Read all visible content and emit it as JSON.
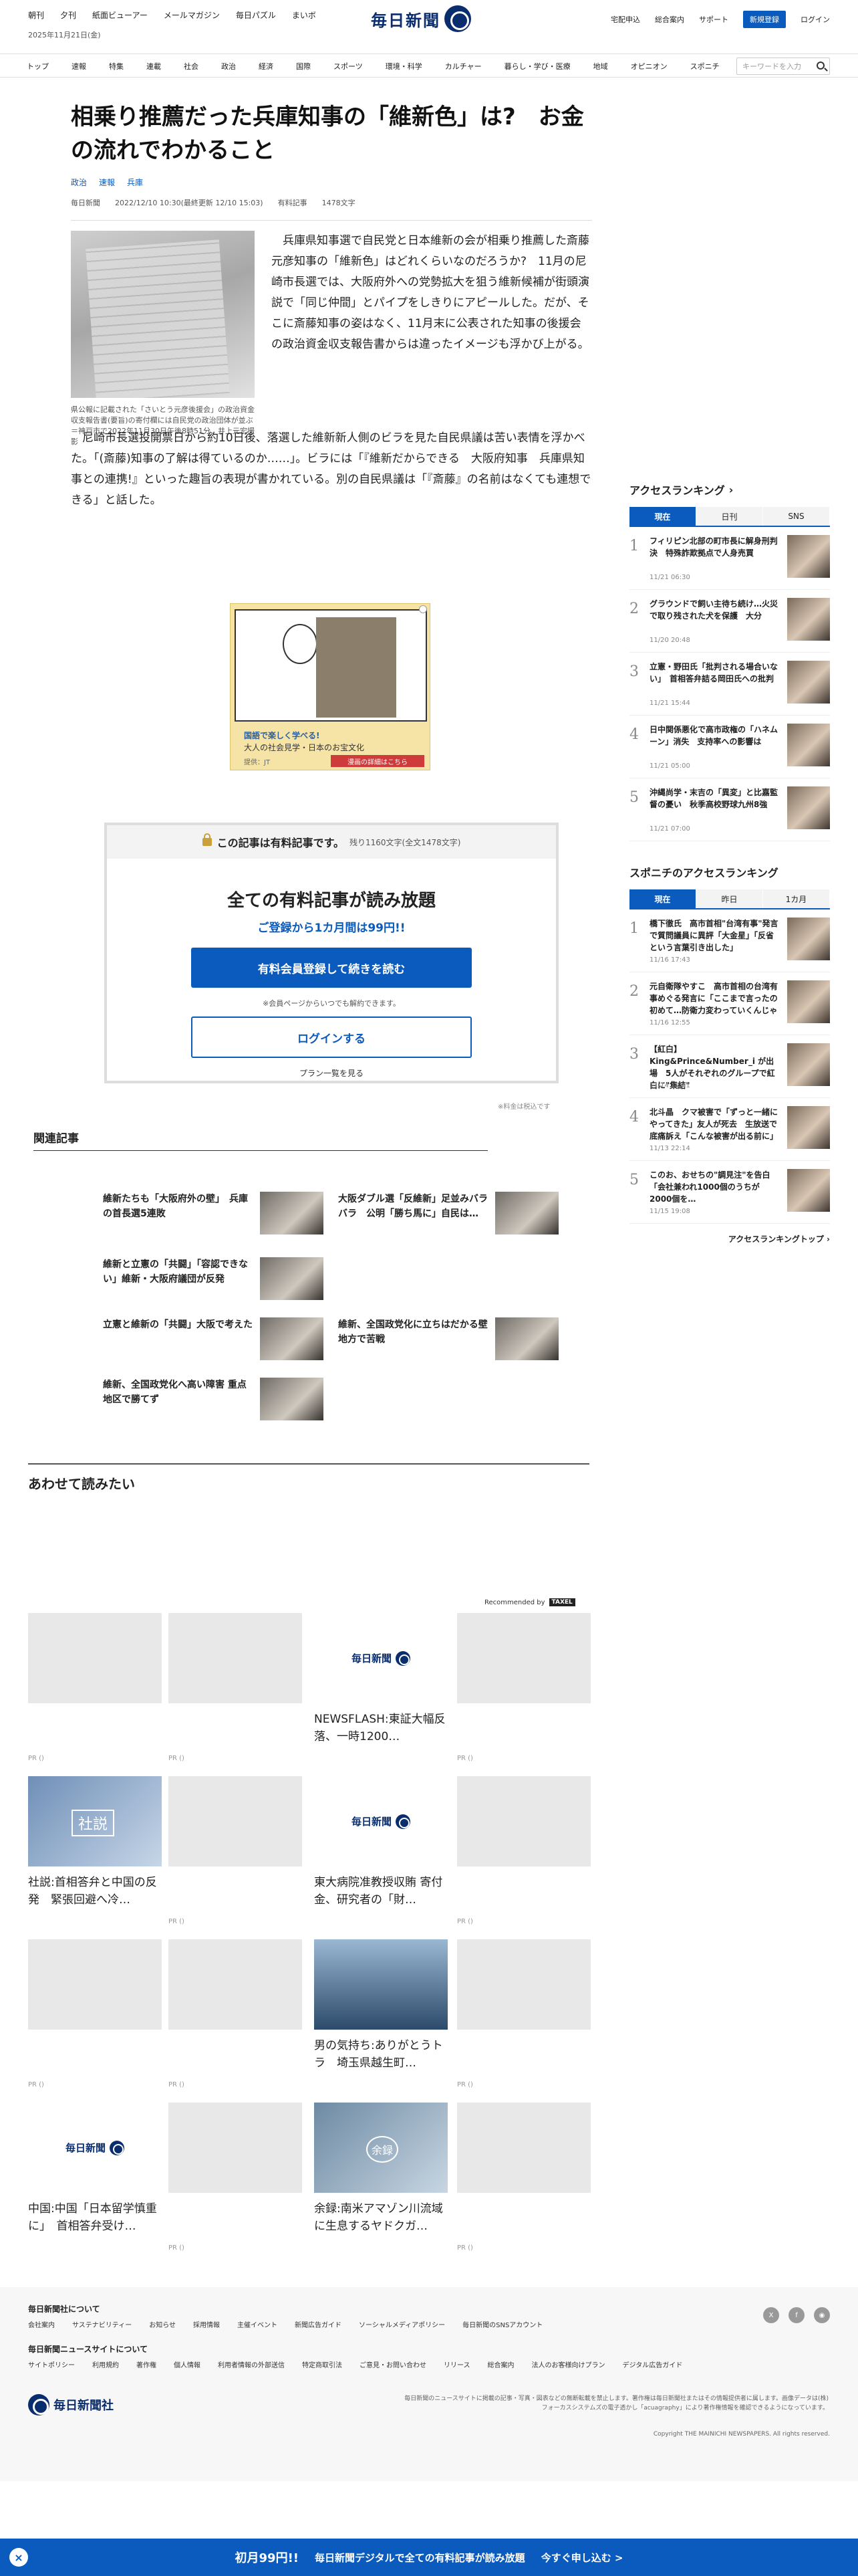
{
  "header": {
    "top_links": [
      "朝刊",
      "夕刊",
      "紙面ビューアー",
      "メールマガジン",
      "毎日パズル",
      "まいボ"
    ],
    "date": "2025年11月21日(金)",
    "logo_text": "毎日新聞",
    "right_links": [
      "宅配申込",
      "総合案内",
      "サポート"
    ],
    "register_label": "新規登録",
    "login_label": "ログイン"
  },
  "nav": {
    "items": [
      "トップ",
      "速報",
      "特集",
      "連載",
      "社会",
      "政治",
      "経済",
      "国際",
      "スポーツ",
      "環境・科学",
      "カルチャー",
      "暮らし・学び・医療",
      "地域",
      "オピニオン",
      "スポニチ"
    ],
    "search_placeholder": "キーワードを入力"
  },
  "article": {
    "title": "相乗り推薦だった兵庫知事の「維新色」は?　お金の流れでわかること",
    "tags": [
      "政治",
      "速報",
      "兵庫"
    ],
    "source": "毎日新聞",
    "date": "2022/12/10 10:30(最終更新 12/10 15:03)",
    "paid_label": "有料記事",
    "char_count": "1478文字",
    "photo_caption": "県公報に記載された「さいとう元彦後援会」の政治資金収支報告書(要旨)の寄付欄には自民党の政治団体が並ぶ＝神戸市で2022年11月30日午後8時51分、井上元宏撮影",
    "para1": "兵庫県知事選で自民党と日本維新の会が相乗り推薦した斎藤元彦知事の「維新色」はどれくらいなのだろうか?　11月の尼崎市長選では、大阪府外への党勢拡大を狙う維新候補が街頭演説で「同じ仲間」とパイプをしきりにアピールした。だが、そこに斎藤知事の姿はなく、11月末に公表された知事の後援会の政治資金収支報告書からは違ったイメージも浮かび上がる。",
    "para2": "尼崎市長選投開票日から約10日後、落選した維新新人側のビラを見た自民県議は苦い表情を浮かべた。「(斎藤)知事の了解は得ているのか……」。ビラには「『維新だからできる　大阪府知事　兵庫県知事との連携!』といった趣旨の表現が書かれている。別の自民県議は「『斎藤』の名前はなくても連想できる」と話した。"
  },
  "ad": {
    "line1": "国語で楽しく学べる!",
    "line2": "大人の社会見学・日本のお宝文化",
    "line3": "提供：JT",
    "cta": "漫画の詳細はこちら"
  },
  "paywall": {
    "head": "この記事は有料記事です。",
    "remaining": "残り1160文字(全文1478文字)",
    "title": "全ての有料記事が読み放題",
    "subtitle": "ご登録から1カ月間は99円!!",
    "primary_button": "有料会員登録して続きを読む",
    "note": "※会員ページからいつでも解約できます。",
    "login_button": "ログインする",
    "plan_link": "プラン一覧を見る",
    "tax_note": "※料金は税込です"
  },
  "related": {
    "heading": "関連記事",
    "items": [
      "維新たちも「大阪府外の壁」　兵庫の首長選5連敗",
      "大阪ダブル選「反維新」足並みバラバラ　公明「勝ち馬に」自民は…",
      "維新と立憲の「共闘」「容認できない」維新・大阪府議団が反発",
      "立憲と維新の「共闘」大阪で考えた",
      "維新、全国政党化に立ちはだかる壁　地方で苦戦",
      "維新、全国政党化へ高い障害 重点地区で勝てず"
    ]
  },
  "awase": {
    "heading": "あわせて読みたい",
    "recommended_by": "Recommended by",
    "provider": "TAXEL",
    "cards": [
      {
        "text": "",
        "pr": "PR ()"
      },
      {
        "text": "",
        "pr": "PR ()"
      },
      {
        "text": "NEWSFLASH:東証大幅反落、一時1200…",
        "pr": ""
      },
      {
        "text": "",
        "pr": "PR ()"
      },
      {
        "text": "社説:首相答弁と中国の反発　緊張回避へ冷…",
        "pr": ""
      },
      {
        "text": "",
        "pr": "PR ()"
      },
      {
        "text": "東大病院准教授収賄 寄付金、研究者の「財…",
        "pr": ""
      },
      {
        "text": "",
        "pr": "PR ()"
      },
      {
        "text": "",
        "pr": "PR ()"
      },
      {
        "text": "",
        "pr": "PR ()"
      },
      {
        "text": "男の気持ち:ありがとうトラ　埼玉県越生町…",
        "pr": ""
      },
      {
        "text": "",
        "pr": "PR ()"
      },
      {
        "text": "中国:中国「日本留学慎重に」　首相答弁受け…",
        "pr": ""
      },
      {
        "text": "",
        "pr": "PR ()"
      },
      {
        "text": "余録:南米アマゾン川流域に生息するヤドクガ…",
        "pr": ""
      },
      {
        "text": "",
        "pr": "PR ()"
      }
    ],
    "card_logo": "毎日新聞",
    "editorial_label": "社説",
    "yoroku_label": "余録"
  },
  "sidebar": {
    "ranking_heading": "アクセスランキング",
    "tabs": [
      "現在",
      "日刊",
      "SNS"
    ],
    "ranks": [
      {
        "num": "1",
        "title": "フィリピン北部の町市長に解身刑判決　特殊詐欺拠点で人身売買",
        "date": "11/21 06:30"
      },
      {
        "num": "2",
        "title": "グラウンドで飼い主待ち続け…火災で取り残された犬を保護　大分",
        "date": "11/20 20:48"
      },
      {
        "num": "3",
        "title": "立憲・野田氏「批判される場合いない」　首相答弁詰る岡田氏への批判",
        "date": "11/21 15:44"
      },
      {
        "num": "4",
        "title": "日中関係悪化で高市政権の「ハネムーン」消失　支持率への影響は",
        "date": "11/21 05:00"
      },
      {
        "num": "5",
        "title": "沖縄尚学・末吉の「異変」と比嘉監督の憂い　秋季高校野球九州8強",
        "date": "11/21 07:00"
      }
    ],
    "sponichi_heading": "スポニチのアクセスランキング",
    "sponichi_tabs": [
      "現在",
      "昨日",
      "1カ月"
    ],
    "sponichi_ranks": [
      {
        "num": "1",
        "title": "橋下徹氏　高市首相\"台湾有事\"発言で質問議員に異評「大金星」「反省という言葉引き出した」",
        "date": "11/16 17:43"
      },
      {
        "num": "2",
        "title": "元自衛隊やすこ　高市首相の台湾有事めぐる発言に「ここまで言ったの初めて…防衛力変わっていくんじゃ",
        "date": "11/16 12:55"
      },
      {
        "num": "3",
        "title": "【紅白】King&Prince&Number_i が出場　5人がそれぞれのグループで紅白に\"集結\"",
        "date": "11/14 12:41"
      },
      {
        "num": "4",
        "title": "北斗晶　クマ被害で「ずっと一緒にやってきた」友人が死去　生放送で底痛訴え「こんな被害が出る前に」",
        "date": "11/13 22:14"
      },
      {
        "num": "5",
        "title": "このお、おせちの\"調見注\"を告白「会社兼われ1000個のうちが2000個を…",
        "date": "11/15 19:08"
      }
    ],
    "more_label": "アクセスランキングトップ"
  },
  "footer": {
    "about_heading": "毎日新聞社について",
    "about_links": [
      "会社案内",
      "サステナビリティー",
      "お知らせ",
      "採用情報",
      "主催イベント",
      "新聞広告ガイド",
      "ソーシャルメディアポリシー",
      "毎日新聞のSNSアカウント"
    ],
    "site_heading": "毎日新聞ニュースサイトについて",
    "site_links": [
      "サイトポリシー",
      "利用規約",
      "著作権",
      "個人情報",
      "利用者情報の外部送信",
      "特定商取引法",
      "ご意見・お問い合わせ",
      "リリース",
      "総合案内",
      "法人のお客様向けプラン",
      "デジタル広告ガイド"
    ],
    "logo": "毎日新聞社",
    "note": "毎日新聞のニュースサイトに掲載の記事・写真・図表などの無断転載を禁止します。著作権は毎日新聞社またはその情報提供者に属します。画像データは(株)フォーカスシステムズの電子透かし「acuagraphy」により著作権情報を確認できるようになっています。",
    "copyright": "Copyright THE MAINICHI NEWSPAPERS. All rights reserved."
  },
  "bottom_banner": {
    "close_icon": "×",
    "price": "初月99円!!",
    "text": "毎日新聞デジタルで全ての有料記事が読み放題",
    "cta": "今すぐ申し込む >"
  }
}
